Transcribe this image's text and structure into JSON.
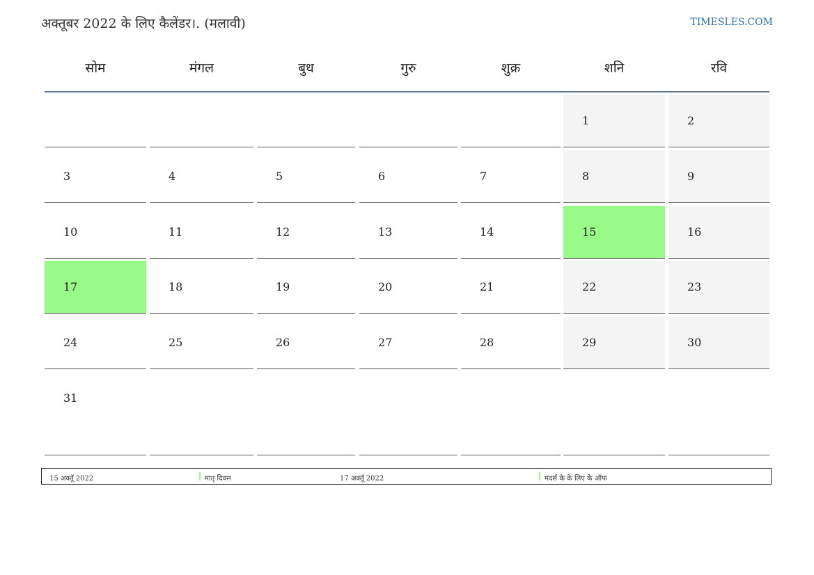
{
  "header": {
    "title": "अक्तूबर 2022 के लिए कैलेंडर।. (मलावी)",
    "site": "TIMESLES.COM"
  },
  "days_of_week": [
    "सोम",
    "मंगल",
    "बुध",
    "गुरु",
    "शुक्र",
    "शनि",
    "रवि"
  ],
  "weeks": [
    [
      "",
      "",
      "",
      "",
      "",
      "1",
      "2"
    ],
    [
      "3",
      "4",
      "5",
      "6",
      "7",
      "8",
      "9"
    ],
    [
      "10",
      "11",
      "12",
      "13",
      "14",
      "15",
      "16"
    ],
    [
      "17",
      "18",
      "19",
      "20",
      "21",
      "22",
      "23"
    ],
    [
      "24",
      "25",
      "26",
      "27",
      "28",
      "29",
      "30"
    ],
    [
      "31",
      "",
      "",
      "",
      "",
      "",
      ""
    ]
  ],
  "holidays": [
    "15",
    "17"
  ],
  "colors": {
    "holiday": "#98fb88",
    "weekend": "#f4f4f4",
    "header_line": "#5b7594",
    "site_link": "#2f6fa8"
  },
  "legend": {
    "date1": "15 अक्तूॅ 2022",
    "name1": "मातृ दिवस",
    "date2": "17 अक्तूॅ 2022",
    "name2": "मदर्स के के लिए के ऑफ"
  }
}
